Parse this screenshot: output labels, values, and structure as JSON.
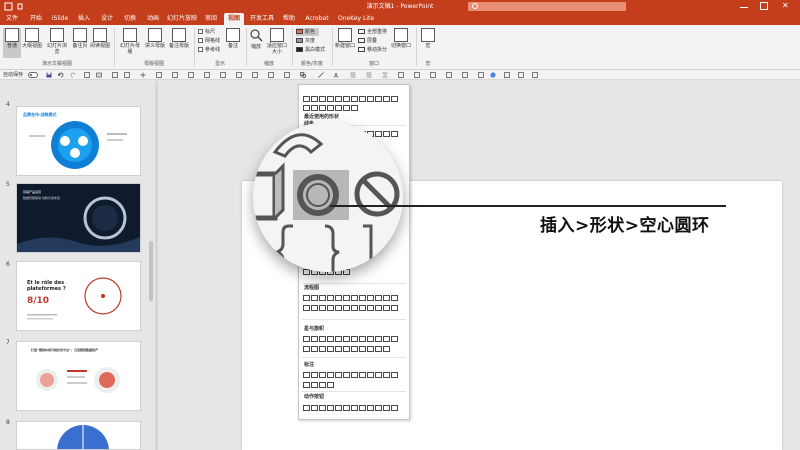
{
  "window": {
    "title": "演示文稿1 - PowerPoint",
    "search_placeholder": "",
    "accent": "#c43e1c"
  },
  "tabs": [
    {
      "label": "文件"
    },
    {
      "label": "开始"
    },
    {
      "label": "iSlide"
    },
    {
      "label": "插入"
    },
    {
      "label": "设计"
    },
    {
      "label": "切换"
    },
    {
      "label": "动画"
    },
    {
      "label": "幻灯片放映"
    },
    {
      "label": "审阅"
    },
    {
      "label": "视图"
    },
    {
      "label": "开发工具"
    },
    {
      "label": "帮助"
    },
    {
      "label": "Acrobat"
    },
    {
      "label": "OneKey Lite"
    }
  ],
  "active_tab": "视图",
  "ribbon": {
    "presentation_views": {
      "group_label": "演示文稿视图",
      "buttons": [
        "普通",
        "大纲视图",
        "幻灯片浏览",
        "备注页",
        "阅读视图"
      ]
    },
    "master_views": {
      "group_label": "母版视图",
      "buttons": [
        "幻灯片母版",
        "讲义母版",
        "备注母版"
      ]
    },
    "show": {
      "group_label": "显示",
      "checkboxes": [
        "标尺",
        "网格线",
        "参考线"
      ],
      "notes_button": "备注"
    },
    "zoom": {
      "group_label": "缩放",
      "buttons": [
        "缩放",
        "适应窗口大小"
      ]
    },
    "color": {
      "group_label": "颜色/灰度",
      "options": [
        "颜色",
        "灰度",
        "黑白模式"
      ]
    },
    "window": {
      "group_label": "窗口",
      "new_window": "新建窗口",
      "options": [
        "全部重排",
        "层叠",
        "移动拆分"
      ],
      "switch": "切换窗口"
    },
    "macros": {
      "group_label": "宏",
      "button": "宏"
    }
  },
  "quick_access": {
    "autosave_label": "自动保存"
  },
  "thumbnails": [
    {
      "number": "4",
      "title": "品牌合作·战略模式"
    },
    {
      "number": "5",
      "title": "营销产品运营",
      "subtitle": "数据智能驱动 创新引领未来"
    },
    {
      "number": "6",
      "title": "Et le rôle des plateformes ?",
      "stat": "8/10"
    },
    {
      "number": "7",
      "title": "打造“营销布局可视化的平台”，沉淀营销数据资产"
    },
    {
      "number": "8"
    }
  ],
  "slide": {
    "caption": "插入>形状>空心圆环"
  },
  "shapes_dropdown": {
    "sections": [
      "最近使用的形状",
      "线条",
      "流程图",
      "星与旗帜",
      "标注",
      "动作按钮"
    ]
  }
}
